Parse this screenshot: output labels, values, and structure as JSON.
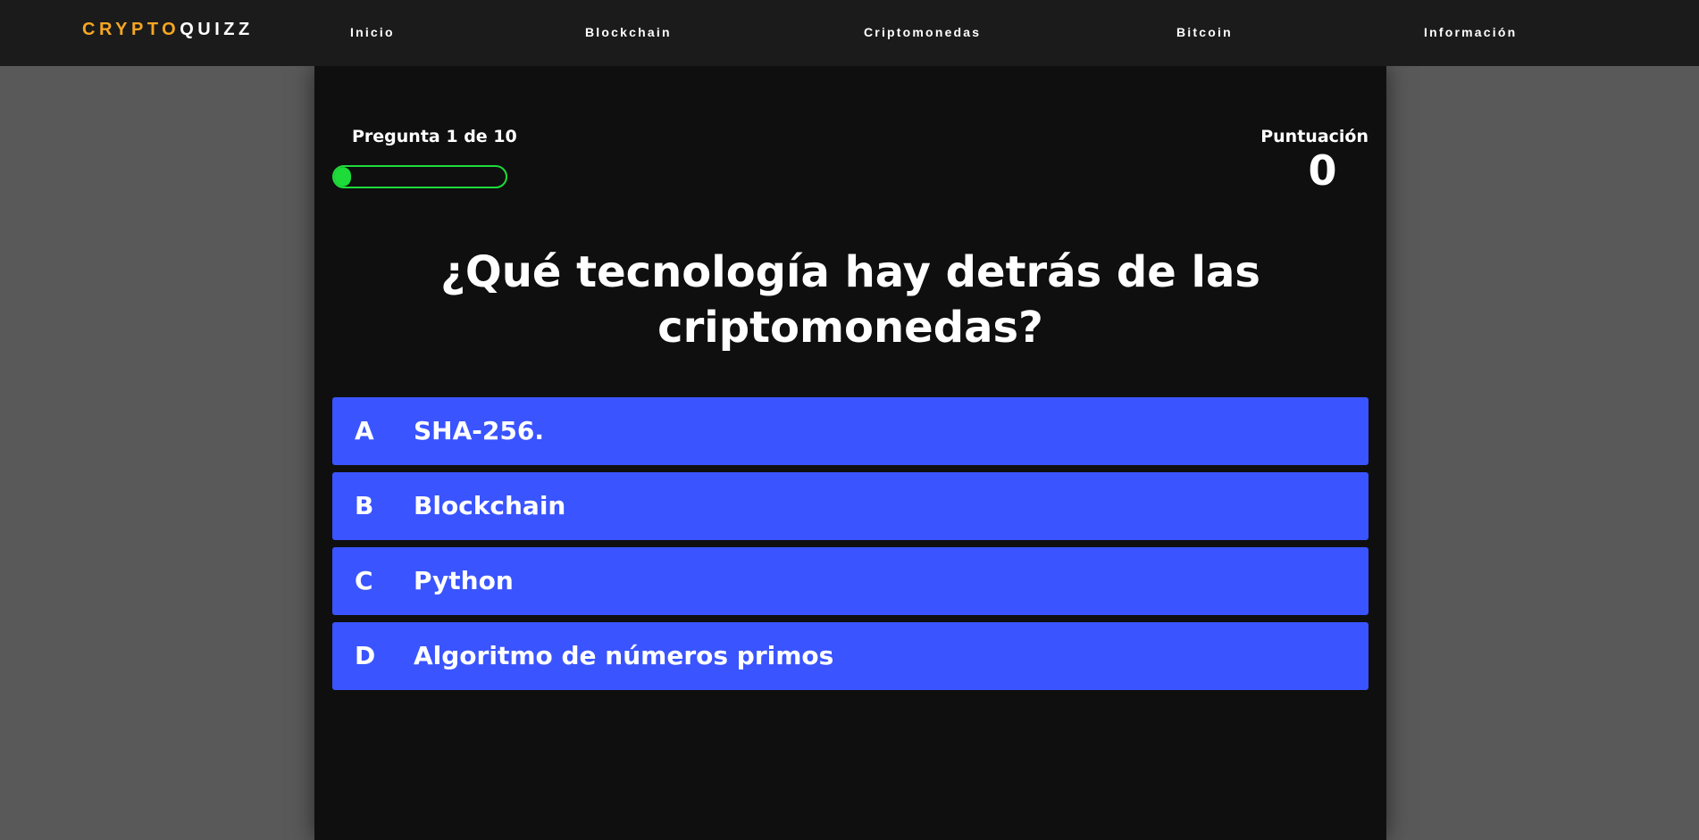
{
  "navbar": {
    "logo_part1": "CRYPTO",
    "logo_part2": "QUIZZ",
    "links": [
      "Inicio",
      "Blockchain",
      "Criptomonedas",
      "Bitcoin",
      "Información"
    ]
  },
  "quiz": {
    "progress_text": "Pregunta 1 de 10",
    "progress_fraction": 0.1,
    "score_label": "Puntuación",
    "score_value": "0",
    "question": "¿Qué tecnología hay detrás de las criptomonedas?",
    "answers": [
      {
        "letter": "A",
        "text": "SHA-256."
      },
      {
        "letter": "B",
        "text": "Blockchain"
      },
      {
        "letter": "C",
        "text": "Python"
      },
      {
        "letter": "D",
        "text": "Algoritmo de números primos"
      }
    ]
  },
  "colors": {
    "background": "#595959",
    "navbar": "#1b1b1b",
    "panel": "#0f0f0f",
    "logo_accent": "#f5a623",
    "progress": "#1ddc3a",
    "answer_button": "#3a54ff"
  }
}
